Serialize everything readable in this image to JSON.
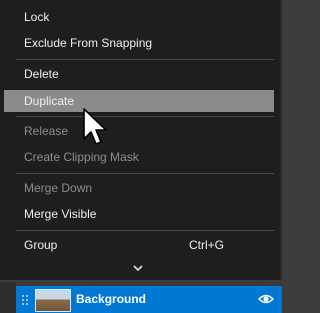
{
  "menu": {
    "items": [
      {
        "label": "Lock",
        "enabled": true
      },
      {
        "label": "Exclude From Snapping",
        "enabled": true
      },
      {
        "label": "Delete",
        "enabled": true
      },
      {
        "label": "Duplicate",
        "enabled": true,
        "highlighted": true
      },
      {
        "label": "Release",
        "enabled": false
      },
      {
        "label": "Create Clipping Mask",
        "enabled": false
      },
      {
        "label": "Merge Down",
        "enabled": false
      },
      {
        "label": "Merge Visible",
        "enabled": true
      },
      {
        "label": "Group",
        "enabled": true,
        "shortcut": "Ctrl+G"
      }
    ],
    "more_icon": "chevron-down-icon"
  },
  "layers": {
    "selected_layer": {
      "name": "Background",
      "visible": true,
      "thumbnail": "landscape-thumbnail",
      "grip_icon": "drag-grip-icon",
      "visibility_icon": "eye-icon"
    }
  },
  "colors": {
    "menu_bg": "#1e1e1e",
    "highlight": "#8b8b8b",
    "selection_accent": "#0078d4",
    "text": "#f0f0f0",
    "disabled_text": "#8d8d8d"
  }
}
